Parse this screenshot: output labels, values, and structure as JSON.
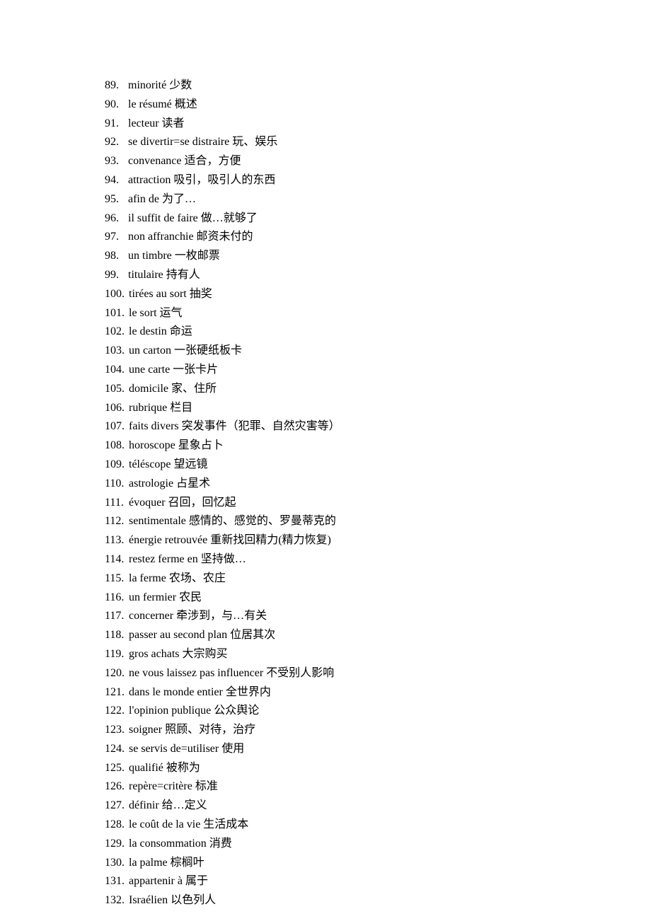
{
  "entries": [
    {
      "num": "89.",
      "text": "minorité  少数",
      "pad": true
    },
    {
      "num": "90.",
      "text": "le résumé  概述",
      "pad": true
    },
    {
      "num": "91.",
      "text": "lecteur  读者",
      "pad": true
    },
    {
      "num": "92.",
      "text": "se divertir=se distraire  玩、娱乐",
      "pad": true
    },
    {
      "num": "93.",
      "text": "convenance  适合，方便",
      "pad": true
    },
    {
      "num": "94.",
      "text": "attraction  吸引，吸引人的东西",
      "pad": true
    },
    {
      "num": "95.",
      "text": "afin de  为了…",
      "pad": true
    },
    {
      "num": "96.",
      "text": "il suffit de faire  做…就够了",
      "pad": true
    },
    {
      "num": "97.",
      "text": "non affranchie  邮资未付的",
      "pad": true
    },
    {
      "num": "98.",
      "text": "un timbre  一枚邮票",
      "pad": true
    },
    {
      "num": "99.",
      "text": "titulaire  持有人",
      "pad": true
    },
    {
      "num": "100.",
      "text": "tirées au sort  抽奖",
      "pad": false
    },
    {
      "num": "101.",
      "text": "le sort  运气",
      "pad": false
    },
    {
      "num": "102.",
      "text": "le destin  命运",
      "pad": false
    },
    {
      "num": "103.",
      "text": "un carton  一张硬纸板卡",
      "pad": false
    },
    {
      "num": "104.",
      "text": "une carte  一张卡片",
      "pad": false
    },
    {
      "num": "105.",
      "text": "domicile  家、住所",
      "pad": false
    },
    {
      "num": "106.",
      "text": "rubrique  栏目",
      "pad": false
    },
    {
      "num": "107.",
      "text": "faits divers  突发事件（犯罪、自然灾害等）",
      "pad": false
    },
    {
      "num": "108.",
      "text": "horoscope  星象占卜",
      "pad": false
    },
    {
      "num": "109.",
      "text": "téléscope  望远镜",
      "pad": false
    },
    {
      "num": "110.",
      "text": "astrologie  占星术",
      "pad": false
    },
    {
      "num": "111.",
      "text": "évoquer  召回，回忆起",
      "pad": false
    },
    {
      "num": "112.",
      "text": "sentimentale  感情的、感觉的、罗曼蒂克的",
      "pad": false
    },
    {
      "num": "113.",
      "text": "énergie retrouvée  重新找回精力(精力恢复)",
      "pad": false
    },
    {
      "num": "114.",
      "text": "restez ferme en  坚持做…",
      "pad": false
    },
    {
      "num": "115.",
      "text": "la ferme  农场、农庄",
      "pad": false
    },
    {
      "num": "116.",
      "text": "un fermier  农民",
      "pad": false
    },
    {
      "num": "117.",
      "text": "concerner  牵涉到，与…有关",
      "pad": false
    },
    {
      "num": "118.",
      "text": "passer au second plan  位居其次",
      "pad": false
    },
    {
      "num": "119.",
      "text": "gros achats  大宗购买",
      "pad": false
    },
    {
      "num": "120.",
      "text": "ne vous laissez pas influencer  不受别人影响",
      "pad": false
    },
    {
      "num": "121.",
      "text": "dans le monde entier  全世界内",
      "pad": false
    },
    {
      "num": "122.",
      "text": "l'opinion publique  公众舆论",
      "pad": false
    },
    {
      "num": "123.",
      "text": "soigner  照顾、对待，治疗",
      "pad": false
    },
    {
      "num": "124.",
      "text": "se servis de=utiliser  使用",
      "pad": false
    },
    {
      "num": "125.",
      "text": "qualifié  被称为",
      "pad": false
    },
    {
      "num": "126.",
      "text": "repère=critère  标准",
      "pad": false
    },
    {
      "num": "127.",
      "text": "définir  给…定义",
      "pad": false
    },
    {
      "num": "128.",
      "text": "le coût de la vie  生活成本",
      "pad": false
    },
    {
      "num": "129.",
      "text": "la consommation  消费",
      "pad": false
    },
    {
      "num": "130.",
      "text": "la palme  棕榈叶",
      "pad": false
    },
    {
      "num": "131.",
      "text": "appartenir à  属于",
      "pad": false
    },
    {
      "num": "132.",
      "text": "Israélien  以色列人",
      "pad": false
    }
  ]
}
